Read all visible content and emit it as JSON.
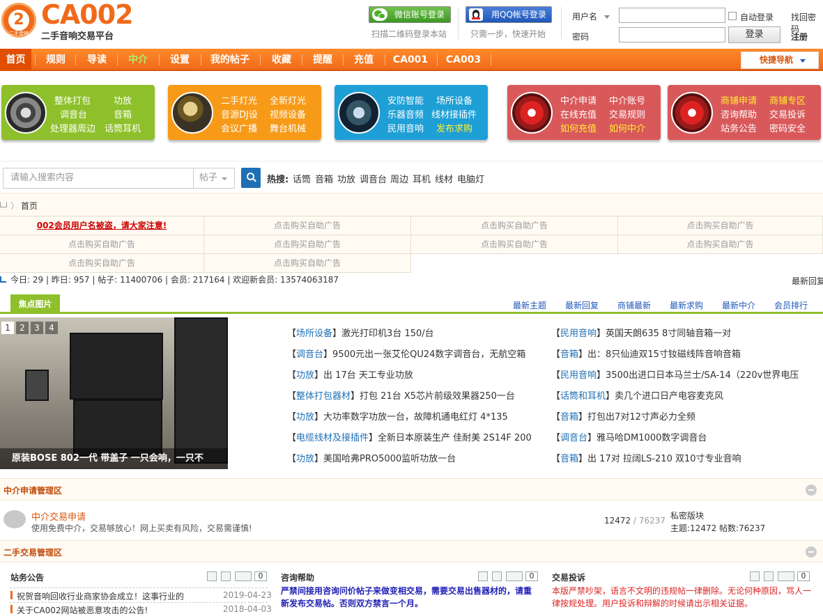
{
  "header": {
    "logo_char": "2",
    "logo_tiny": "二手音响",
    "logo_text": "CA002",
    "logo_sub": "二手音响交易平台",
    "wechat_login": "微信账号登录",
    "wechat_hint": "扫描二维码登录本站",
    "qq_login": "用QQ帐号登录",
    "qq_hint": "只需一步，快速开始",
    "username_label": "用户名",
    "password_label": "密码",
    "auto_login": "自动登录",
    "forgot": "找回密码",
    "login_btn": "登录",
    "register": "注册"
  },
  "nav": {
    "items": [
      "首页",
      "规则",
      "导读",
      "中介",
      "设置",
      "我的帖子",
      "收藏",
      "提醒",
      "充值",
      "CA001",
      "CA003"
    ],
    "quick_nav": "快捷导航"
  },
  "categories": [
    {
      "rows": [
        [
          "整体打包",
          "功放"
        ],
        [
          "调音台",
          "音箱"
        ],
        [
          "处理器周边",
          "话筒耳机"
        ]
      ]
    },
    {
      "rows": [
        [
          "二手灯光",
          "全新灯光"
        ],
        [
          "音源DJ设",
          "视频设备"
        ],
        [
          "会议广播",
          "舞台机械"
        ]
      ]
    },
    {
      "rows": [
        [
          "安防智能",
          "场所设备"
        ],
        [
          "乐器音频",
          "线材接插件"
        ],
        [
          "民用音响",
          "发布求购"
        ]
      ]
    },
    {
      "rows": [
        [
          "中介申请",
          "中介账号"
        ],
        [
          "在线充值",
          "交易规则"
        ],
        [
          "如何充值",
          "如何中介"
        ]
      ]
    },
    {
      "rows": [
        [
          "商铺申请",
          "商铺专区"
        ],
        [
          "咨询帮助",
          "交易投诉"
        ],
        [
          "站务公告",
          "密码安全"
        ]
      ]
    }
  ],
  "search": {
    "placeholder": "请输入搜索内容",
    "type": "帖子",
    "hot_label": "热搜:",
    "hot": [
      "话筒",
      "音箱",
      "功放",
      "调音台",
      "周边",
      "耳机",
      "线材",
      "电脑灯"
    ]
  },
  "breadcrumb": "首页",
  "ads": {
    "notice": "002会员用户名被盗，请大家注意!",
    "placeholder": "点击购买自助广告"
  },
  "stats": {
    "text": "今日: 29 | 昨日: 957 | 帖子: 11400706 | 会员: 217164 | 欢迎新会员: 13574063187",
    "right": "最新回复"
  },
  "tabs": {
    "focus": "焦点图片",
    "links": [
      "最新主题",
      "最新回复",
      "商铺最新",
      "最新求购",
      "最新中介",
      "会员排行"
    ]
  },
  "photo": {
    "caption": "原装BOSE 802一代 带盖子 一只会响，一只不",
    "pages": [
      "1",
      "2",
      "3",
      "4"
    ]
  },
  "posts_left": [
    {
      "tag": "场所设备",
      "title": "激光打印机3台 150/台"
    },
    {
      "tag": "调音台",
      "title": "9500元出一张艾伦QU24数字调音台，无航空箱"
    },
    {
      "tag": "功放",
      "title": "出 17台 天工专业功放"
    },
    {
      "tag": "整体打包器材",
      "title": "打包 21台 X5芯片前级效果器250一台"
    },
    {
      "tag": "功放",
      "title": "大功率数字功放一台，故障机通电红灯 4*135"
    },
    {
      "tag": "电缆线材及接插件",
      "title": "全新日本原装生产 佳耐美 2S14F 200"
    },
    {
      "tag": "功放",
      "title": "美国哈弗PRO5000监听功放一台"
    }
  ],
  "posts_right": [
    {
      "tag": "民用音响",
      "title": "英国天朗635 8寸同轴音箱一对"
    },
    {
      "tag": "音箱",
      "title": "出：8只仙迪双15寸钕磁线阵音响音箱"
    },
    {
      "tag": "民用音响",
      "title": "3500出进口日本马兰士/SA-14（220v世界电压"
    },
    {
      "tag": "话筒和耳机",
      "title": "卖几个进口日产电容麦克风"
    },
    {
      "tag": "音箱",
      "title": "打包出7对12寸声必力全频"
    },
    {
      "tag": "调音台",
      "title": "雅马哈DM1000数字调音台"
    },
    {
      "tag": "音箱",
      "title": "出 17对 拉阔LS-210 双10寸专业音响"
    }
  ],
  "section1": {
    "title": "中介申请管理区",
    "forum": "中介交易申请",
    "desc": "使用免费中介，交易够放心！网上买卖有风险，交易需谨慎!",
    "count_a": "12472",
    "count_b": "76237",
    "side_title": "私密版块",
    "side_stats": "主题:12472 帖数:76237"
  },
  "section2": {
    "title": "二手交易管理区",
    "forums": [
      {
        "title": "站务公告",
        "count": "0",
        "items": [
          {
            "t": "祝贺音响回收行业商家协会成立！这事行业的",
            "d": "2019-04-23"
          },
          {
            "t": "关于CA002网站被恶意攻击的公告!",
            "d": "2018-04-03"
          }
        ]
      },
      {
        "title": "咨询帮助",
        "count": "0",
        "desc": "严禁间接用咨询问价帖子来做变相交易，需要交易出售器材的，请重新发布交易帖。否则双方禁言一个月。"
      },
      {
        "title": "交易投诉",
        "count": "0",
        "desc": "本版严禁吵架，语言不文明的违规帖一律删除。无论何种原因，骂人一律按规处理。用户投诉和辩解的时候请出示相关证据。"
      }
    ]
  }
}
